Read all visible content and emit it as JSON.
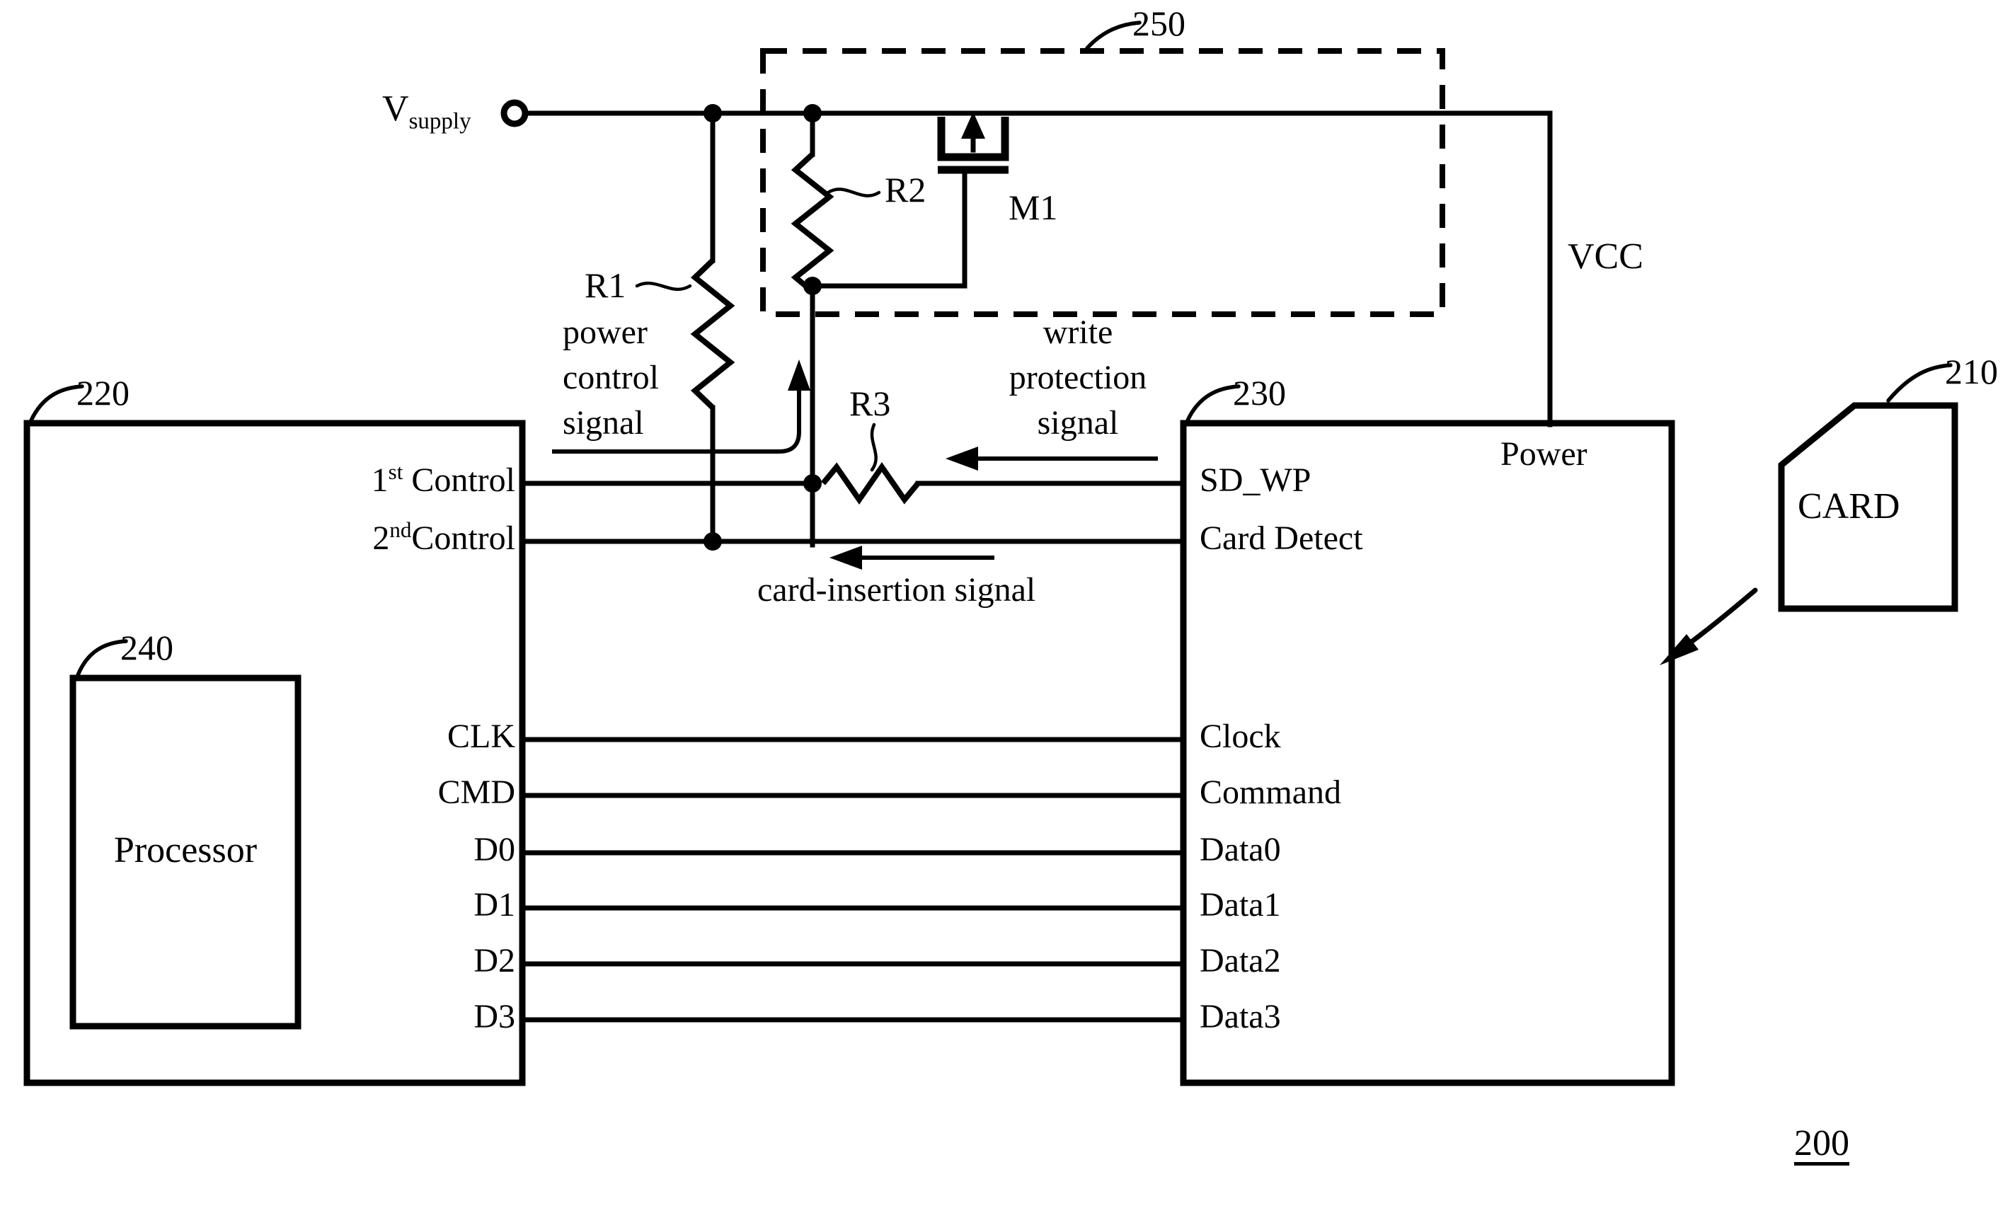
{
  "figure": {
    "number": "200",
    "reference_numerals": {
      "card": "210",
      "host_controller": "220",
      "card_socket": "230",
      "processor": "240",
      "power_switch_block": "250"
    }
  },
  "supply": {
    "label_main": "V",
    "label_sub": "supply",
    "terminal_icon": "open-circle-terminal"
  },
  "components": {
    "r1": "R1",
    "r2": "R2",
    "r3": "R3",
    "m1": "M1"
  },
  "signals": {
    "power_control": "power\ncontrol\nsignal",
    "power_control_line1": "power",
    "power_control_line2": "control",
    "power_control_line3": "signal",
    "write_protection_line1": "write",
    "write_protection_line2": "protection",
    "write_protection_line3": "signal",
    "card_insertion": "card-insertion signal",
    "vcc": "VCC"
  },
  "blocks": {
    "host": {
      "ref": "220",
      "pins_left_group": [
        {
          "label_main": "1",
          "label_sup": "st",
          "label_rest": "Control"
        },
        {
          "label_main": "2",
          "label_sup": "nd",
          "label_rest": "Control"
        }
      ],
      "pins_bus": [
        "CLK",
        "CMD",
        "D0",
        "D1",
        "D2",
        "D3"
      ]
    },
    "processor": {
      "ref": "240",
      "label": "Processor"
    },
    "socket": {
      "ref": "230",
      "power_label": "Power",
      "pins_top": [
        "SD_WP",
        "Card Detect"
      ],
      "pins_bus": [
        "Clock",
        "Command",
        "Data0",
        "Data1",
        "Data2",
        "Data3"
      ]
    },
    "card": {
      "ref": "210",
      "label": "CARD"
    }
  },
  "colors": {
    "ink": "#000000",
    "paper": "#ffffff"
  }
}
